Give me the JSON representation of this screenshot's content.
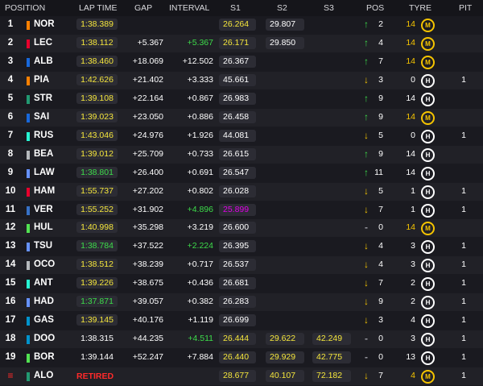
{
  "headers": [
    "POSITION",
    "LAP TIME",
    "GAP",
    "INTERVAL",
    "S1",
    "S2",
    "S3",
    "POS",
    "TYRE",
    "PIT"
  ],
  "colors": {
    "purple": "#e000e8",
    "green": "#3ddc4a",
    "yellow": "#f5e63c",
    "white": "#ffffff",
    "medium": "#f5c400",
    "hard": "#ffffff",
    "retired": "#ff2a2a"
  },
  "rows": [
    {
      "pos": "1",
      "abbr": "NOR",
      "team": "#ff8000",
      "lap": "1:38.389",
      "lap_c": "yellow",
      "lap_box": true,
      "gap": "",
      "int": "",
      "int_c": "white",
      "s1": "26.264",
      "s1_c": "yellow",
      "s2": "29.807",
      "s2_c": "white",
      "s3": "",
      "s3_c": "white",
      "dir": "up",
      "poschg": "2",
      "tyre_laps": "14",
      "tyre": "M",
      "pit": ""
    },
    {
      "pos": "2",
      "abbr": "LEC",
      "team": "#e8002d",
      "lap": "1:38.112",
      "lap_c": "yellow",
      "lap_box": true,
      "gap": "+5.367",
      "int": "+5.367",
      "int_c": "green",
      "s1": "26.171",
      "s1_c": "yellow",
      "s2": "29.850",
      "s2_c": "white",
      "s3": "",
      "s3_c": "white",
      "dir": "up",
      "poschg": "4",
      "tyre_laps": "14",
      "tyre": "M",
      "pit": ""
    },
    {
      "pos": "3",
      "abbr": "ALB",
      "team": "#1868db",
      "lap": "1:38.460",
      "lap_c": "yellow",
      "lap_box": true,
      "gap": "+18.069",
      "int": "+12.502",
      "int_c": "white",
      "s1": "26.367",
      "s1_c": "white",
      "s2": "",
      "s2_c": "white",
      "s3": "",
      "s3_c": "white",
      "dir": "up",
      "poschg": "7",
      "tyre_laps": "14",
      "tyre": "M",
      "pit": ""
    },
    {
      "pos": "4",
      "abbr": "PIA",
      "team": "#ff8000",
      "lap": "1:42.626",
      "lap_c": "yellow",
      "lap_box": true,
      "gap": "+21.402",
      "int": "+3.333",
      "int_c": "white",
      "s1": "45.661",
      "s1_c": "white",
      "s2": "",
      "s2_c": "white",
      "s3": "",
      "s3_c": "white",
      "dir": "down",
      "poschg": "3",
      "tyre_laps": "0",
      "tyre": "H",
      "pit": "1"
    },
    {
      "pos": "5",
      "abbr": "STR",
      "team": "#229971",
      "lap": "1:39.108",
      "lap_c": "yellow",
      "lap_box": true,
      "gap": "+22.164",
      "int": "+0.867",
      "int_c": "white",
      "s1": "26.983",
      "s1_c": "white",
      "s2": "",
      "s2_c": "white",
      "s3": "",
      "s3_c": "white",
      "dir": "up",
      "poschg": "9",
      "tyre_laps": "14",
      "tyre": "H",
      "pit": ""
    },
    {
      "pos": "6",
      "abbr": "SAI",
      "team": "#1868db",
      "lap": "1:39.023",
      "lap_c": "yellow",
      "lap_box": true,
      "gap": "+23.050",
      "int": "+0.886",
      "int_c": "white",
      "s1": "26.458",
      "s1_c": "white",
      "s2": "",
      "s2_c": "white",
      "s3": "",
      "s3_c": "white",
      "dir": "up",
      "poschg": "9",
      "tyre_laps": "14",
      "tyre": "M",
      "pit": ""
    },
    {
      "pos": "7",
      "abbr": "RUS",
      "team": "#27f4d2",
      "lap": "1:43.046",
      "lap_c": "yellow",
      "lap_box": true,
      "gap": "+24.976",
      "int": "+1.926",
      "int_c": "white",
      "s1": "44.081",
      "s1_c": "white",
      "s2": "",
      "s2_c": "white",
      "s3": "",
      "s3_c": "white",
      "dir": "down",
      "poschg": "5",
      "tyre_laps": "0",
      "tyre": "H",
      "pit": "1"
    },
    {
      "pos": "8",
      "abbr": "BEA",
      "team": "#b6babd",
      "lap": "1:39.012",
      "lap_c": "yellow",
      "lap_box": true,
      "gap": "+25.709",
      "int": "+0.733",
      "int_c": "white",
      "s1": "26.615",
      "s1_c": "white",
      "s2": "",
      "s2_c": "white",
      "s3": "",
      "s3_c": "white",
      "dir": "up",
      "poschg": "9",
      "tyre_laps": "14",
      "tyre": "H",
      "pit": ""
    },
    {
      "pos": "9",
      "abbr": "LAW",
      "team": "#6692ff",
      "lap": "1:38.801",
      "lap_c": "green",
      "lap_box": true,
      "gap": "+26.400",
      "int": "+0.691",
      "int_c": "white",
      "s1": "26.547",
      "s1_c": "white",
      "s2": "",
      "s2_c": "white",
      "s3": "",
      "s3_c": "white",
      "dir": "up",
      "poschg": "11",
      "tyre_laps": "14",
      "tyre": "H",
      "pit": ""
    },
    {
      "pos": "10",
      "abbr": "HAM",
      "team": "#e8002d",
      "lap": "1:55.737",
      "lap_c": "yellow",
      "lap_box": true,
      "gap": "+27.202",
      "int": "+0.802",
      "int_c": "white",
      "s1": "26.028",
      "s1_c": "white",
      "s2": "",
      "s2_c": "white",
      "s3": "",
      "s3_c": "white",
      "dir": "down",
      "poschg": "5",
      "tyre_laps": "1",
      "tyre": "H",
      "pit": "1"
    },
    {
      "pos": "11",
      "abbr": "VER",
      "team": "#3671c6",
      "lap": "1:55.252",
      "lap_c": "yellow",
      "lap_box": true,
      "gap": "+31.902",
      "int": "+4.896",
      "int_c": "green",
      "s1": "25.899",
      "s1_c": "purple",
      "s2": "",
      "s2_c": "white",
      "s3": "",
      "s3_c": "white",
      "dir": "down",
      "poschg": "7",
      "tyre_laps": "1",
      "tyre": "H",
      "pit": "1"
    },
    {
      "pos": "12",
      "abbr": "HUL",
      "team": "#52e252",
      "lap": "1:40.998",
      "lap_c": "yellow",
      "lap_box": true,
      "gap": "+35.298",
      "int": "+3.219",
      "int_c": "white",
      "s1": "26.600",
      "s1_c": "white",
      "s2": "",
      "s2_c": "white",
      "s3": "",
      "s3_c": "white",
      "dir": "same",
      "poschg": "0",
      "tyre_laps": "14",
      "tyre": "M",
      "pit": ""
    },
    {
      "pos": "13",
      "abbr": "TSU",
      "team": "#6692ff",
      "lap": "1:38.784",
      "lap_c": "green",
      "lap_box": true,
      "gap": "+37.522",
      "int": "+2.224",
      "int_c": "green",
      "s1": "26.395",
      "s1_c": "white",
      "s2": "",
      "s2_c": "white",
      "s3": "",
      "s3_c": "white",
      "dir": "down",
      "poschg": "4",
      "tyre_laps": "3",
      "tyre": "H",
      "pit": "1"
    },
    {
      "pos": "14",
      "abbr": "OCO",
      "team": "#b6babd",
      "lap": "1:38.512",
      "lap_c": "yellow",
      "lap_box": true,
      "gap": "+38.239",
      "int": "+0.717",
      "int_c": "white",
      "s1": "26.537",
      "s1_c": "white",
      "s2": "",
      "s2_c": "white",
      "s3": "",
      "s3_c": "white",
      "dir": "down",
      "poschg": "4",
      "tyre_laps": "3",
      "tyre": "H",
      "pit": "1"
    },
    {
      "pos": "15",
      "abbr": "ANT",
      "team": "#27f4d2",
      "lap": "1:39.226",
      "lap_c": "yellow",
      "lap_box": true,
      "gap": "+38.675",
      "int": "+0.436",
      "int_c": "white",
      "s1": "26.681",
      "s1_c": "white",
      "s2": "",
      "s2_c": "white",
      "s3": "",
      "s3_c": "white",
      "dir": "down",
      "poschg": "7",
      "tyre_laps": "2",
      "tyre": "H",
      "pit": "1"
    },
    {
      "pos": "16",
      "abbr": "HAD",
      "team": "#6692ff",
      "lap": "1:37.871",
      "lap_c": "green",
      "lap_box": true,
      "gap": "+39.057",
      "int": "+0.382",
      "int_c": "white",
      "s1": "26.283",
      "s1_c": "white",
      "s2": "",
      "s2_c": "white",
      "s3": "",
      "s3_c": "white",
      "dir": "down",
      "poschg": "9",
      "tyre_laps": "2",
      "tyre": "H",
      "pit": "1"
    },
    {
      "pos": "17",
      "abbr": "GAS",
      "team": "#0093cc",
      "lap": "1:39.145",
      "lap_c": "yellow",
      "lap_box": true,
      "gap": "+40.176",
      "int": "+1.119",
      "int_c": "white",
      "s1": "26.699",
      "s1_c": "white",
      "s2": "",
      "s2_c": "white",
      "s3": "",
      "s3_c": "white",
      "dir": "down",
      "poschg": "3",
      "tyre_laps": "4",
      "tyre": "H",
      "pit": "1"
    },
    {
      "pos": "18",
      "abbr": "DOO",
      "team": "#0093cc",
      "lap": "1:38.315",
      "lap_c": "white",
      "lap_box": false,
      "gap": "+44.235",
      "int": "+4.511",
      "int_c": "green",
      "s1": "26.444",
      "s1_c": "yellow",
      "s2": "29.622",
      "s2_c": "yellow",
      "s3": "42.249",
      "s3_c": "yellow",
      "dir": "same",
      "poschg": "0",
      "tyre_laps": "3",
      "tyre": "H",
      "pit": "1"
    },
    {
      "pos": "19",
      "abbr": "BOR",
      "team": "#52e252",
      "lap": "1:39.144",
      "lap_c": "white",
      "lap_box": false,
      "gap": "+52.247",
      "int": "+7.884",
      "int_c": "white",
      "s1": "26.440",
      "s1_c": "yellow",
      "s2": "29.929",
      "s2_c": "yellow",
      "s3": "42.775",
      "s3_c": "yellow",
      "dir": "same",
      "poschg": "0",
      "tyre_laps": "13",
      "tyre": "H",
      "pit": "1"
    },
    {
      "pos": "",
      "abbr": "ALO",
      "team": "#229971",
      "lap": "RETIRED",
      "lap_c": "retired",
      "lap_box": false,
      "retired": true,
      "gap": "",
      "int": "",
      "int_c": "white",
      "s1": "28.677",
      "s1_c": "yellow",
      "s2": "40.107",
      "s2_c": "yellow",
      "s3": "72.182",
      "s3_c": "yellow",
      "dir": "down",
      "poschg": "7",
      "tyre_laps": "4",
      "tyre": "M",
      "pit": "1"
    }
  ]
}
